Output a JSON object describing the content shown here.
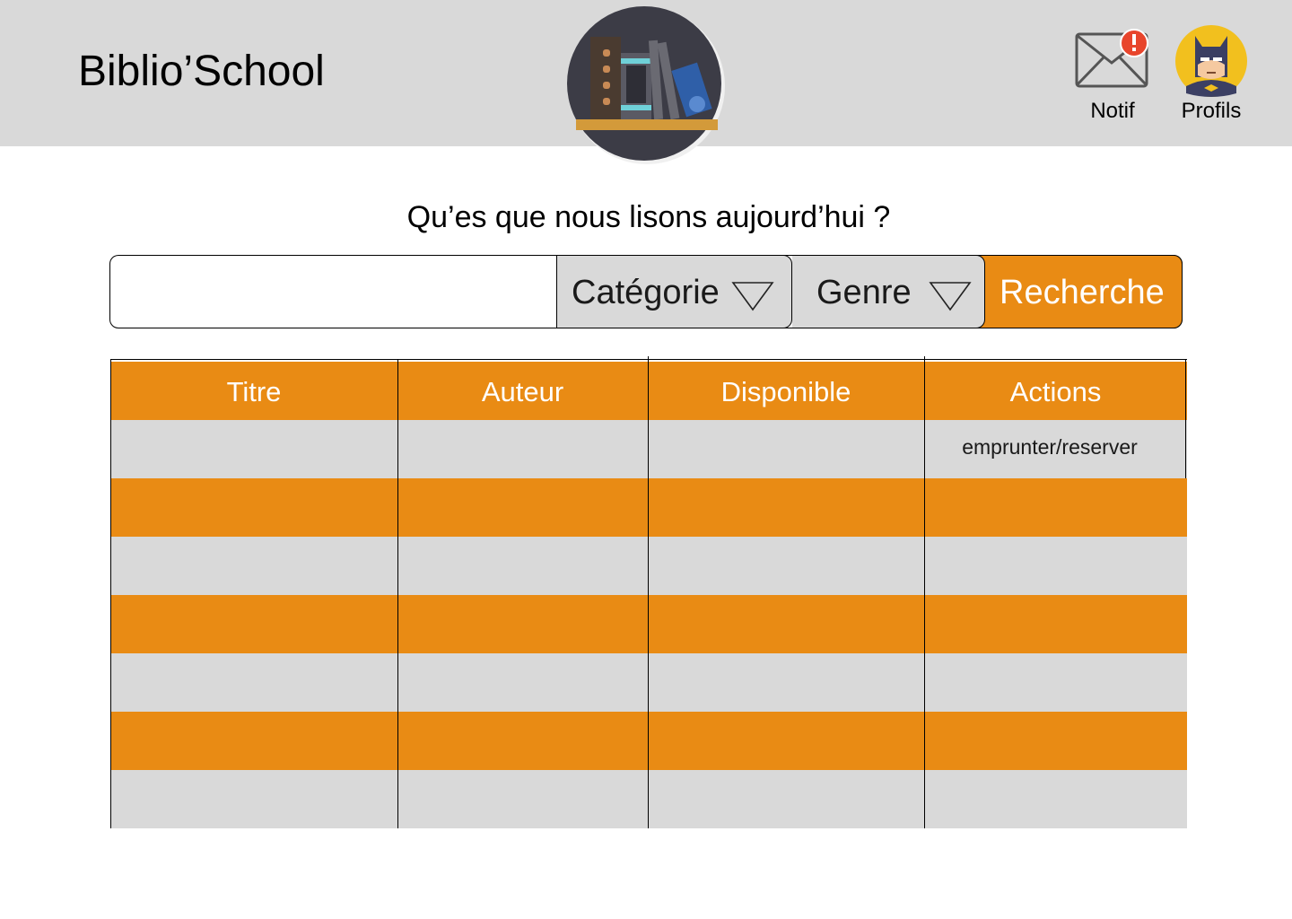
{
  "header": {
    "app_title": "Biblio’School",
    "notif_label": "Notif",
    "profile_label": "Profils"
  },
  "search": {
    "question": "Qu’es que nous lisons aujourd’hui ?",
    "input_value": "",
    "category_label": "Catégorie",
    "genre_label": "Genre",
    "button_label": "Recherche"
  },
  "table": {
    "columns": [
      "Titre",
      "Auteur",
      "Disponible",
      "Actions"
    ],
    "row_action": "emprunter/reserver",
    "rows": [
      [
        "",
        "",
        "",
        "emprunter/reserver"
      ],
      [
        "",
        "",
        "",
        ""
      ],
      [
        "",
        "",
        "",
        ""
      ],
      [
        "",
        "",
        "",
        ""
      ],
      [
        "",
        "",
        "",
        ""
      ],
      [
        "",
        "",
        "",
        ""
      ],
      [
        "",
        "",
        "",
        ""
      ]
    ]
  },
  "colors": {
    "accent": "#e98b14",
    "header_bg": "#d9d9d9",
    "row_gray": "#d9d9d9",
    "alert": "#e8452c",
    "avatar_bg": "#f2c01e"
  },
  "icons": {
    "logo": "bookshelf-logo",
    "notification": "envelope-alert-icon",
    "profile": "batman-avatar"
  }
}
